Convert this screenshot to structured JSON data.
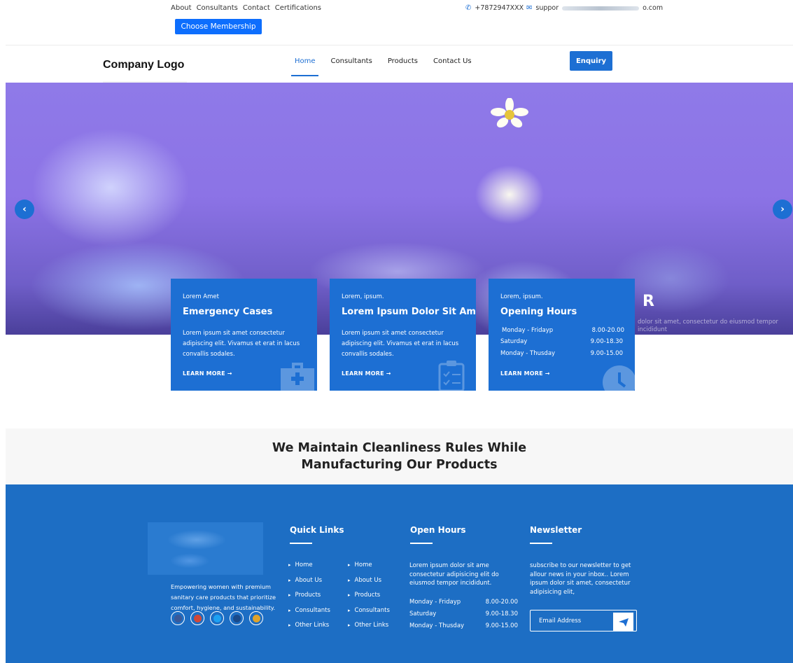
{
  "topbar": {
    "links": [
      "About",
      "Consultants",
      "Contact",
      "Certifications"
    ],
    "membership_label": "Choose Membership",
    "phone": "+7872947XXX",
    "email_prefix": "suppor",
    "email_suffix": "o.com"
  },
  "navbar": {
    "logo": "Company Logo",
    "menu": [
      "Home",
      "Consultants",
      "Products",
      "Contact Us"
    ],
    "enquiry_label": "Enquiry"
  },
  "hero": {
    "overlay_title": "R",
    "overlay_text": "dolor sit amet, consectetur do eiusmod tempor incididunt",
    "prev": "‹",
    "next": "›"
  },
  "cards": [
    {
      "eyebrow": "Lorem Amet",
      "title": "Emergency Cases",
      "text": "Lorem ipsum sit amet consectetur adipiscing elit. Vivamus et erat in lacus convallis sodales.",
      "link": "LEARN MORE →",
      "icon": "medical-kit-icon"
    },
    {
      "eyebrow": "Lorem, ipsum.",
      "title": "Lorem Ipsum Dolor Sit Amet.",
      "text": "Lorem ipsum sit amet consectetur adipiscing elit. Vivamus et erat in lacus convallis sodales.",
      "link": "LEARN MORE →",
      "icon": "clipboard-icon"
    },
    {
      "eyebrow": "Lorem, ipsum.",
      "title": "Opening Hours",
      "hours": [
        {
          "day": "Monday - Fridayp",
          "time": "8.00-20.00"
        },
        {
          "day": "Saturday",
          "time": "9.00-18.30"
        },
        {
          "day": "Monday - Thusday",
          "time": "9.00-15.00"
        }
      ],
      "link": "LEARN MORE →",
      "icon": "clock-icon"
    }
  ],
  "headline": {
    "line1": "We Maintain Cleanliness Rules While",
    "line2": "Manufacturing Our Products"
  },
  "footer": {
    "description": "Empowering women with premium sanitary care products that prioritize comfort, hygiene, and sustainability.",
    "socials": [
      "facebook-icon",
      "google-plus-icon",
      "twitter-icon",
      "vimeo-icon",
      "pinterest-icon"
    ],
    "quick_links": {
      "heading": "Quick Links",
      "col1": [
        "Home",
        "About Us",
        "Products",
        "Consultants",
        "Other Links"
      ],
      "col2": [
        "Home",
        "About Us",
        "Products",
        "Consultants",
        "Other Links"
      ]
    },
    "open_hours": {
      "heading": "Open Hours",
      "text": "Lorem ipsum dolor sit ame consectetur adipisicing elit do eiusmod tempor incididunt.",
      "rows": [
        {
          "day": "Monday - Fridayp",
          "time": "8.00-20.00"
        },
        {
          "day": "Saturday",
          "time": "9.00-18.30"
        },
        {
          "day": "Monday - Thusday",
          "time": "9.00-15.00"
        }
      ]
    },
    "newsletter": {
      "heading": "Newsletter",
      "text": "subscribe to our newsletter to get allour news in your inbox.. Lorem ipsum dolor sit amet, consectetur adipisicing elit,",
      "placeholder": "Email Address"
    }
  },
  "colors": {
    "primary": "#1d6fd3",
    "button": "#0d6efd",
    "footer_bg": "#1d6ec4",
    "hero": "#8c73e6"
  }
}
